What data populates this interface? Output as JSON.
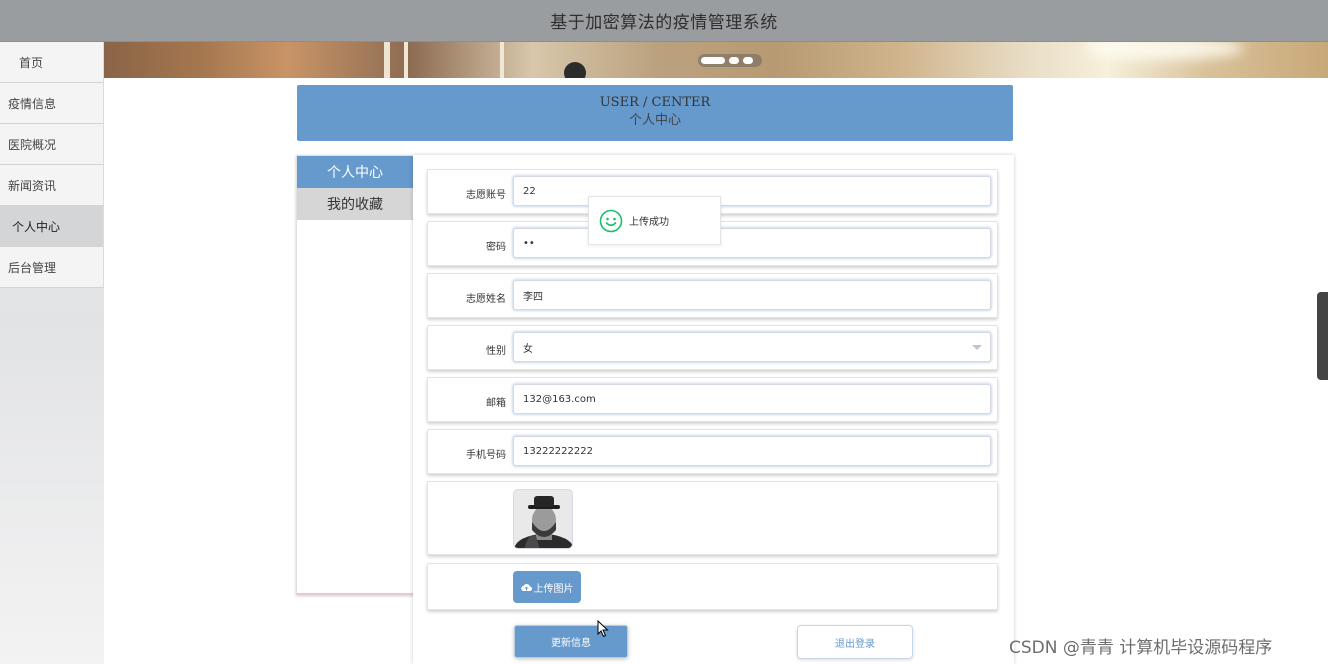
{
  "app": {
    "title": "基于加密算法的疫情管理系统"
  },
  "sidebar": {
    "items": [
      {
        "label": "首页"
      },
      {
        "label": "疫情信息"
      },
      {
        "label": "医院概况"
      },
      {
        "label": "新闻资讯"
      },
      {
        "label": "个人中心",
        "active": true
      },
      {
        "label": "后台管理"
      }
    ]
  },
  "section_header": {
    "en": "USER / CENTER",
    "cn": "个人中心"
  },
  "user_tabs": [
    {
      "label": "个人中心",
      "active": true
    },
    {
      "label": "我的收藏"
    }
  ],
  "form": {
    "account": {
      "label": "志愿账号",
      "value": "22"
    },
    "password": {
      "label": "密码",
      "value": "••"
    },
    "name": {
      "label": "志愿姓名",
      "value": "李四"
    },
    "gender": {
      "label": "性别",
      "value": "女"
    },
    "email": {
      "label": "邮箱",
      "value": "132@163.com"
    },
    "phone": {
      "label": "手机号码",
      "value": "13222222222"
    }
  },
  "upload_button": {
    "label": "上传图片",
    "icon": "cloud-upload-icon"
  },
  "actions": {
    "update_label": "更新信息",
    "logout_label": "退出登录"
  },
  "toast": {
    "message": "上传成功",
    "icon": "smile-icon",
    "color": "#19be6b"
  },
  "watermark": "CSDN @青青  计算机毕设源码程序",
  "colors": {
    "accent": "#6699cc",
    "topbar": "#9a9d9f"
  }
}
